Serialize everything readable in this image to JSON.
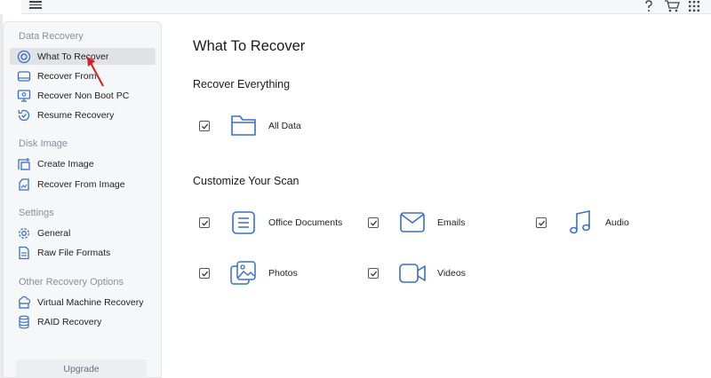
{
  "colors": {
    "accent": "#3a6fc4",
    "sidebar_bg": "#f6f7f9",
    "active_bg": "#dfe2e6",
    "arrow": "#d62020"
  },
  "topbar": {
    "menu_icon": "hamburger-icon",
    "right_icons": [
      "help-icon",
      "cart-icon",
      "apps-grid-icon"
    ]
  },
  "sidebar": {
    "sections": [
      {
        "title": "Data Recovery",
        "items": [
          {
            "label": "What To Recover",
            "icon": "target-icon",
            "active": true
          },
          {
            "label": "Recover From",
            "icon": "drive-icon"
          },
          {
            "label": "Recover Non Boot PC",
            "icon": "monitor-icon"
          },
          {
            "label": "Resume Recovery",
            "icon": "resume-icon"
          }
        ]
      },
      {
        "title": "Disk Image",
        "items": [
          {
            "label": "Create Image",
            "icon": "create-image-icon"
          },
          {
            "label": "Recover From Image",
            "icon": "image-file-icon"
          }
        ]
      },
      {
        "title": "Settings",
        "items": [
          {
            "label": "General",
            "icon": "gear-icon"
          },
          {
            "label": "Raw File Formats",
            "icon": "raw-file-icon"
          }
        ]
      },
      {
        "title": "Other Recovery Options",
        "items": [
          {
            "label": "Virtual Machine Recovery",
            "icon": "cloud-box-icon"
          },
          {
            "label": "RAID Recovery",
            "icon": "database-icon"
          }
        ]
      }
    ],
    "upgrade_label": "Upgrade"
  },
  "main": {
    "title": "What To Recover",
    "recover_everything": {
      "title": "Recover Everything",
      "options": [
        {
          "label": "All Data",
          "icon": "folder-icon",
          "checked": true
        }
      ]
    },
    "customize": {
      "title": "Customize Your Scan",
      "options": [
        {
          "label": "Office Documents",
          "icon": "document-icon",
          "checked": true
        },
        {
          "label": "Emails",
          "icon": "envelope-icon",
          "checked": true
        },
        {
          "label": "Audio",
          "icon": "music-note-icon",
          "checked": true
        },
        {
          "label": "Photos",
          "icon": "photo-icon",
          "checked": true
        },
        {
          "label": "Videos",
          "icon": "video-camera-icon",
          "checked": true
        }
      ]
    }
  }
}
